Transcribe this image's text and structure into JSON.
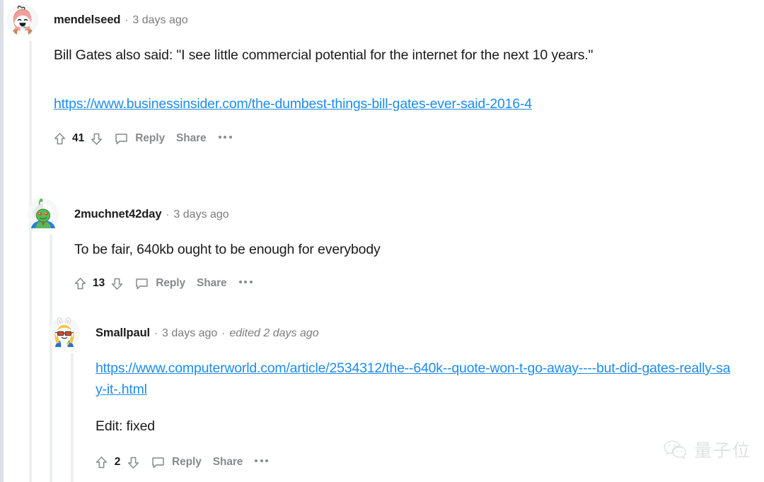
{
  "page": {
    "platform": "reddit-comment-thread",
    "background_color": "#ffffff",
    "link_color": "#1e8ced",
    "text_color": "#1a1a1b",
    "muted_color": "#7c7c7c",
    "action_color": "#878a8c",
    "thread_rail_color": "#edeff1",
    "page_edge_color": "#dae0e6"
  },
  "comments": [
    {
      "author": "mendelseed",
      "separator": "·",
      "timestamp": "3 days ago",
      "edited": "",
      "body": "Bill Gates also said: \"I see little commercial potential for the internet for the next 10 years.\"",
      "link": "https://www.businessinsider.com/the-dumbest-things-bill-gates-ever-said-2016-4",
      "score": "41",
      "reply_label": "Reply",
      "share_label": "Share",
      "avatar": "avatar-pink-hood"
    },
    {
      "author": "2muchnet42day",
      "separator": "·",
      "timestamp": "3 days ago",
      "edited": "",
      "body": "To be fair, 640kb ought to be enough for everybody",
      "link": "",
      "score": "13",
      "reply_label": "Reply",
      "share_label": "Share",
      "avatar": "avatar-green-alien"
    },
    {
      "author": "Smallpaul",
      "separator": "·",
      "timestamp": "3 days ago",
      "edited": "edited 2 days ago",
      "body": "Edit: fixed",
      "link": "https://www.computerworld.com/article/2534312/the--640k--quote-won-t-go-away----but-did-gates-really-say-it-.html",
      "score": "2",
      "reply_label": "Reply",
      "share_label": "Share",
      "avatar": "avatar-bunny-glasses"
    }
  ],
  "watermark": {
    "text": "量子位",
    "icon": "wechat-icon"
  }
}
